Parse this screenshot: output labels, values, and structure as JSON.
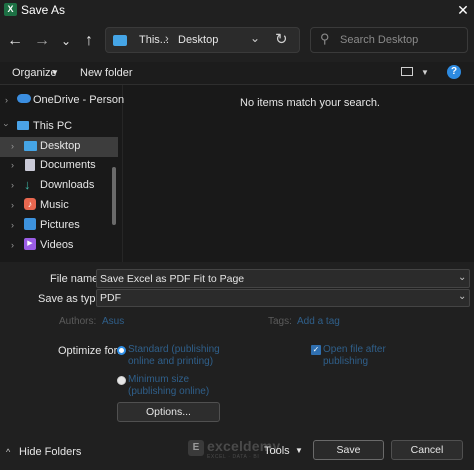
{
  "window": {
    "title": "Save As",
    "app_icon_letter": "X"
  },
  "nav": {
    "back_icon": "arrow-left-icon",
    "forward_icon": "arrow-right-icon",
    "recent_icon": "chevron-down-icon",
    "up_icon": "arrow-up-icon",
    "address": {
      "segment1": "This...",
      "separator": "›",
      "segment2": "Desktop"
    },
    "search_placeholder": "Search Desktop"
  },
  "toolbar": {
    "organize_label": "Organize",
    "new_folder_label": "New folder"
  },
  "sidebar": {
    "items": [
      {
        "label": "OneDrive - Person",
        "icon": "cloud-icon",
        "color": "#3b8ee0"
      },
      {
        "label": "This PC",
        "icon": "computer-icon",
        "color": "#4aa3e8"
      },
      {
        "label": "Desktop",
        "icon": "desktop-icon",
        "color": "#45a5e6"
      },
      {
        "label": "Documents",
        "icon": "document-icon",
        "color": "#c9c9d6"
      },
      {
        "label": "Downloads",
        "icon": "download-icon",
        "color": "#3fb8a7"
      },
      {
        "label": "Music",
        "icon": "music-icon",
        "color": "#e8674f"
      },
      {
        "label": "Pictures",
        "icon": "pictures-icon",
        "color": "#3d92dd"
      },
      {
        "label": "Videos",
        "icon": "videos-icon",
        "color": "#9b5de5"
      }
    ]
  },
  "content": {
    "empty_message": "No items match your search."
  },
  "form": {
    "file_name_label": "File name:",
    "file_name_value": "Save Excel as PDF Fit to Page",
    "save_type_label": "Save as type:",
    "save_type_value": "PDF",
    "authors_label": "Authors:",
    "authors_value": "Asus",
    "tags_label": "Tags:",
    "tags_value": "Add a tag",
    "optimize_label": "Optimize for:",
    "standard_line1": "Standard (publishing",
    "standard_line2": "online and printing)",
    "minimum_line1": "Minimum size",
    "minimum_line2": "(publishing online)",
    "open_after_line1": "Open file after",
    "open_after_line2": "publishing",
    "options_button": "Options...",
    "hide_folders_label": "Hide Folders",
    "tools_label": "Tools",
    "save_button": "Save",
    "cancel_button": "Cancel"
  },
  "watermark": {
    "text": "exceldemy",
    "sub": "EXCEL · DATA · BI"
  },
  "colors": {
    "accent": "#2f8fe6",
    "excel_green": "#1d7044"
  }
}
